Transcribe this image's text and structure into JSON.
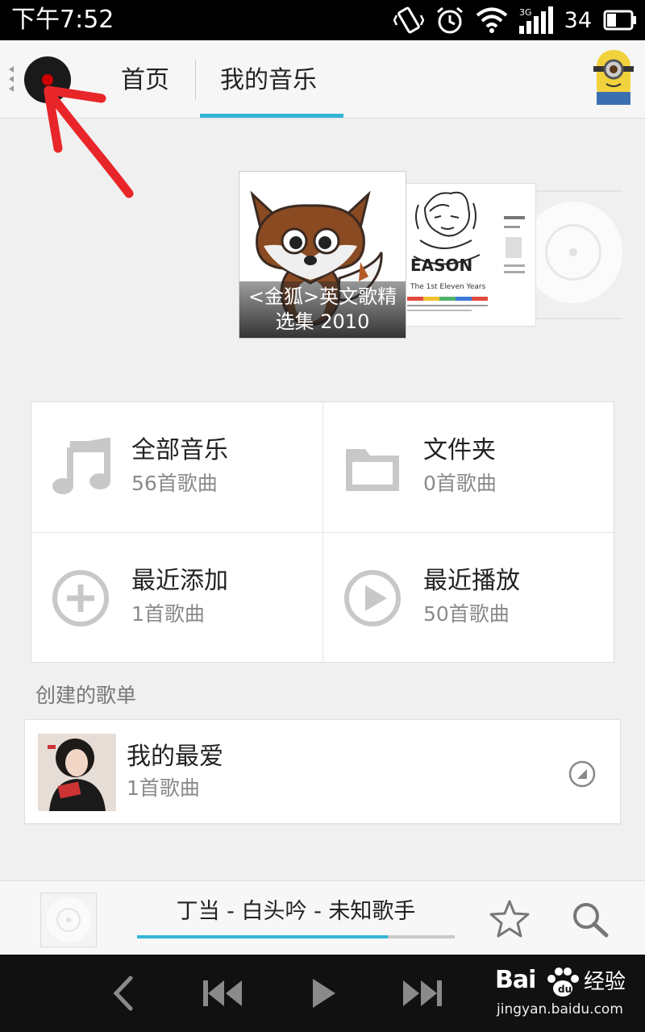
{
  "status_bar": {
    "time": "下午7:52",
    "battery_percent": "34",
    "network_label": "3G",
    "icons": [
      "vibrate-icon",
      "alarm-icon",
      "wifi-icon",
      "signal-icon",
      "battery-icon"
    ]
  },
  "header": {
    "tabs": [
      {
        "label": "首页",
        "active": false
      },
      {
        "label": "我的音乐",
        "active": true
      }
    ],
    "accent_color": "#33b5d8"
  },
  "carousel": {
    "albums": [
      {
        "caption_line1": "<金狐>英文歌精",
        "caption_line2": "选集 2010"
      },
      {
        "cover_text_main": "EASON",
        "cover_text_sub": "The 1st Eleven Years"
      }
    ]
  },
  "categories": [
    {
      "title": "全部音乐",
      "count": "56首歌曲",
      "icon": "music-note-icon"
    },
    {
      "title": "文件夹",
      "count": "0首歌曲",
      "icon": "folder-icon"
    },
    {
      "title": "最近添加",
      "count": "1首歌曲",
      "icon": "add-circle-icon"
    },
    {
      "title": "最近播放",
      "count": "50首歌曲",
      "icon": "play-circle-icon"
    }
  ],
  "playlists": {
    "section_title": "创建的歌单",
    "items": [
      {
        "title": "我的最爱",
        "count": "1首歌曲"
      }
    ]
  },
  "mini_player": {
    "now_playing": "丁当 - 白头吟 - 未知歌手",
    "progress": 0.79
  },
  "watermark": {
    "logo": "Bai",
    "logo_suffix": "经验",
    "url": "jingyan.baidu.com"
  }
}
